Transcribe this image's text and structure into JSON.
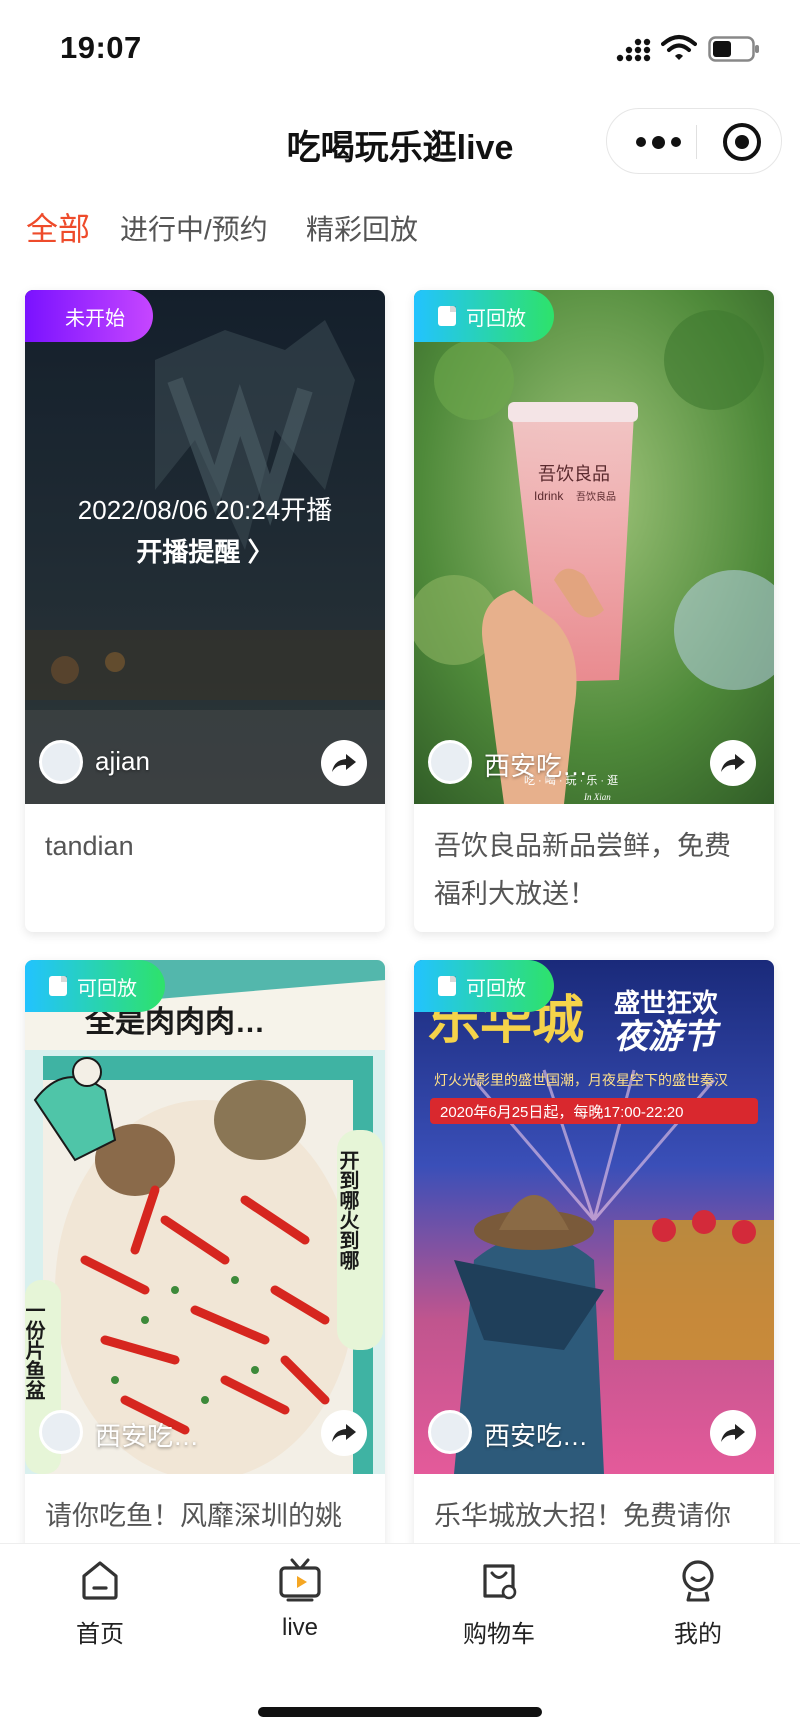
{
  "status_bar": {
    "time": "19:07"
  },
  "nav": {
    "title": "吃喝玩乐逛live"
  },
  "tabs": [
    {
      "label": "全部",
      "active": true
    },
    {
      "label": "进行中/预约",
      "active": false
    },
    {
      "label": "精彩回放",
      "active": false
    }
  ],
  "cards": [
    {
      "badge": "未开始",
      "badge_style": "upcoming",
      "start_time": "2022/08/06 20:24开播",
      "remind_label": "开播提醒 〉",
      "author": "ajian",
      "title": "tandian"
    },
    {
      "badge": "可回放",
      "badge_style": "replay",
      "author": "西安吃…",
      "cup_brand": "吾饮良品",
      "cup_brand_en": "Idrink",
      "cup_sub": "吾饮良品",
      "caption": "吃 · 喝 · 玩 · 乐 · 逛",
      "caption_sub": "In Xian",
      "title": "吾饮良品新品尝鲜，免费福利大放送！"
    },
    {
      "badge": "可回放",
      "badge_style": "replay",
      "author": "西安吃…",
      "poster_top": "全是肉肉肉…",
      "poster_side": "开到哪火到哪",
      "poster_left": "一份片鱼盆",
      "title": "请你吃鱼！风靡深圳的姚"
    },
    {
      "badge": "可回放",
      "badge_style": "replay",
      "author": "西安吃…",
      "poster_title": "乐华城",
      "poster_sub1": "盛世狂欢",
      "poster_sub2": "夜游节",
      "poster_line1": "灯火光影里的盛世国潮，月夜星空下的盛世秦汉",
      "poster_line2": "2020年6月25日起，每晚17:00-22:20",
      "title": "乐华城放大招！免费请你"
    }
  ],
  "bottom_nav": [
    {
      "label": "首页",
      "icon": "home-icon"
    },
    {
      "label": "live",
      "icon": "tv-icon"
    },
    {
      "label": "购物车",
      "icon": "cart-icon"
    },
    {
      "label": "我的",
      "icon": "profile-icon"
    }
  ],
  "colors": {
    "accent": "#ee4b2b",
    "badge_upcoming": "#8a1cff",
    "badge_replay": "#2ed6a0"
  }
}
